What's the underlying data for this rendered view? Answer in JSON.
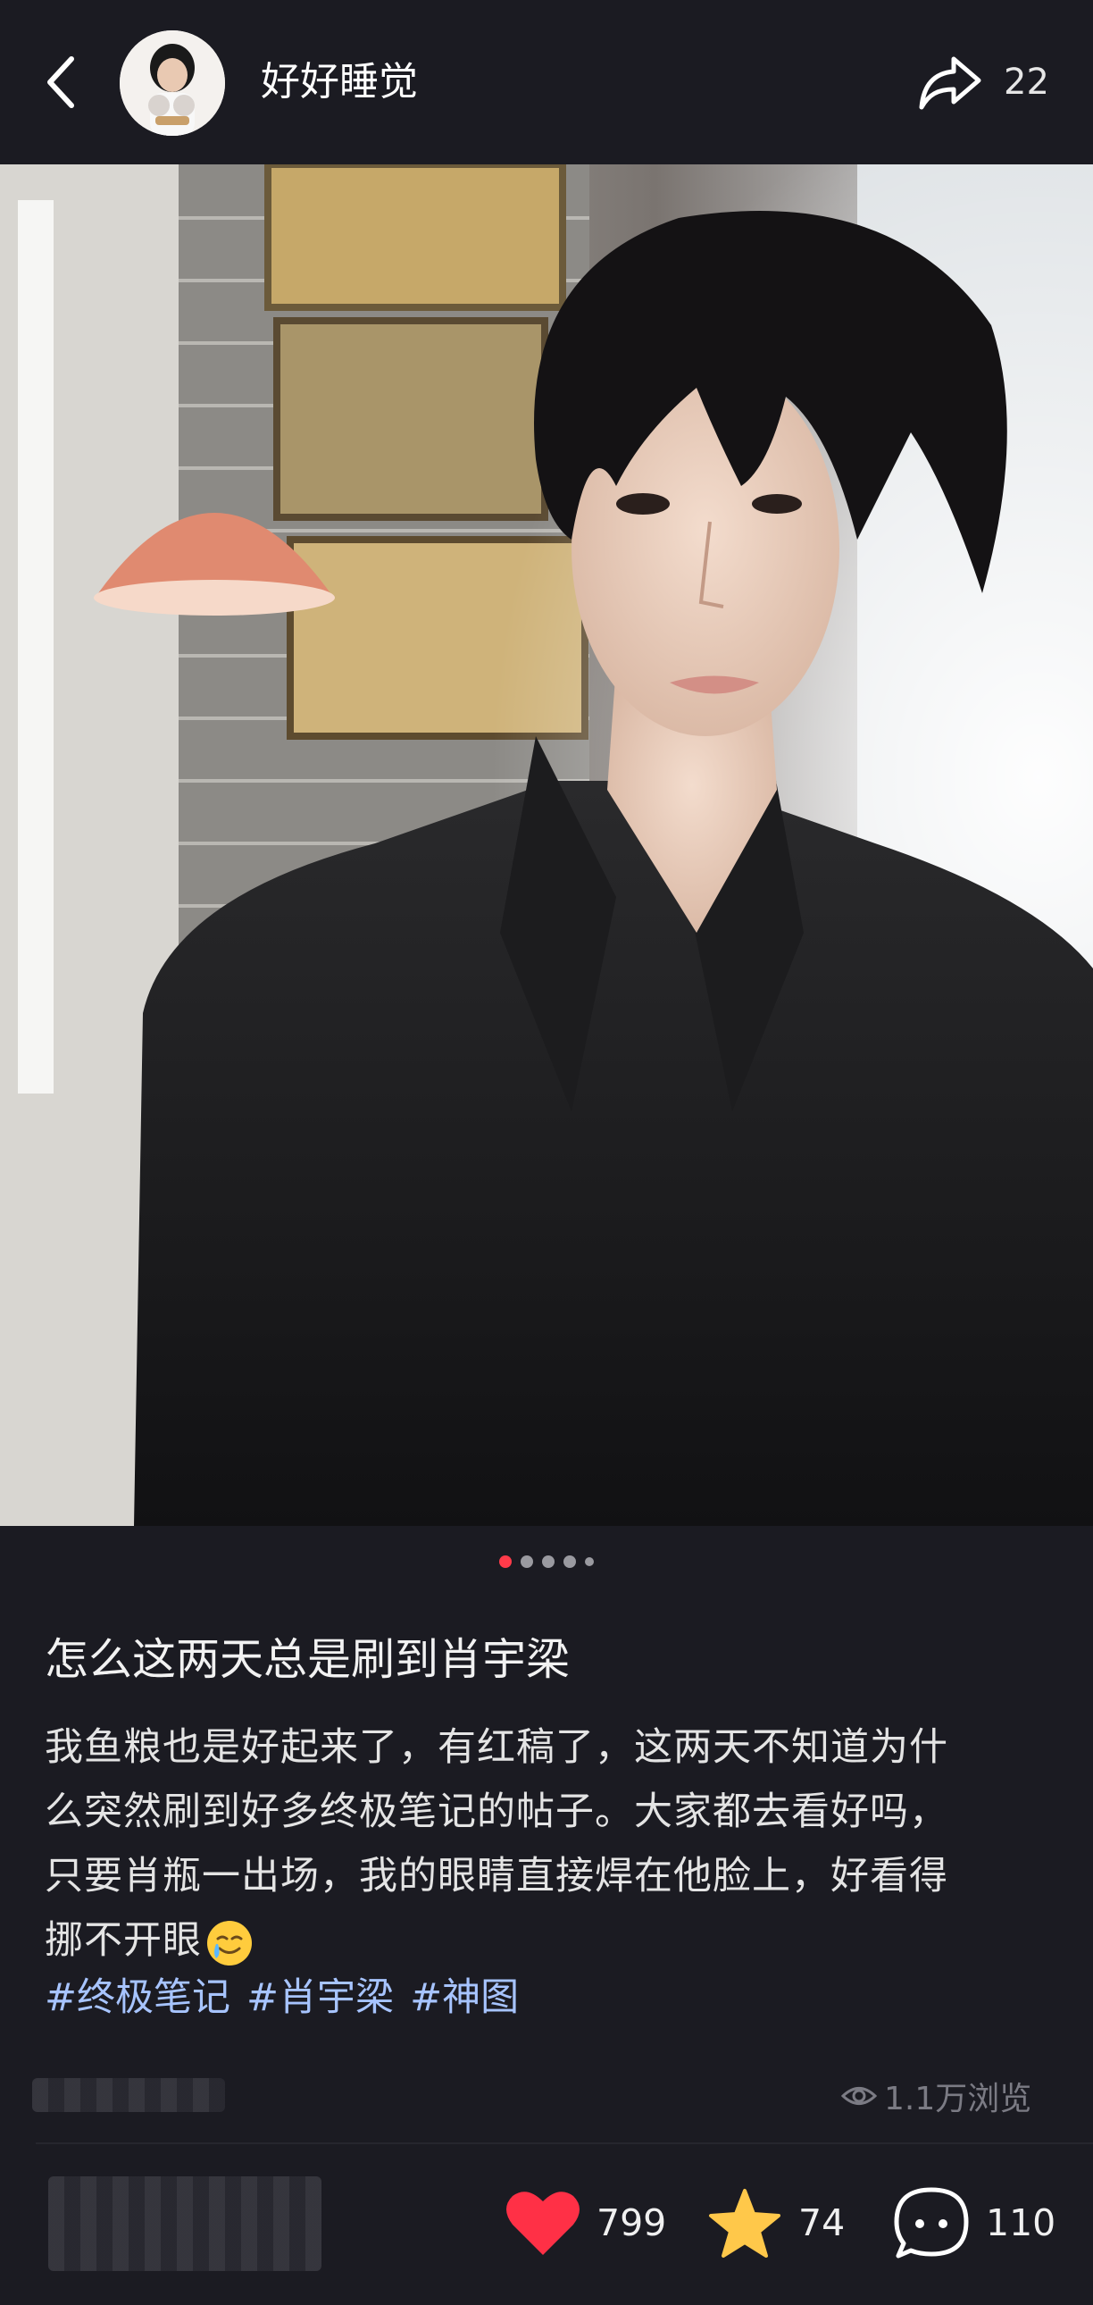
{
  "header": {
    "username": "好好睡觉",
    "share_count": "22"
  },
  "gallery": {
    "total_images": 5,
    "current_index": 1
  },
  "post": {
    "title": "怎么这两天总是刷到肖宇梁",
    "body_lines": [
      "我鱼粮也是好起来了，有红稿了，这两天不知道为什",
      "么突然刷到好多终极笔记的帖子。大家都去看好吗，",
      "只要肖瓶一出场，我的眼睛直接焊在他脸上，好看得",
      "挪不开眼"
    ],
    "tags": [
      "#终极笔记",
      "#肖宇梁",
      "#神图"
    ],
    "views": "1.1万浏览"
  },
  "actions": {
    "like_count": "799",
    "favorite_count": "74",
    "comment_count": "110"
  },
  "colors": {
    "background": "#1b1b22",
    "like_red": "#ff3046",
    "star_yellow": "#ffc84a",
    "tag_blue": "#a7c4ff",
    "active_dot": "#ff3b4a"
  },
  "icons": [
    "back-icon",
    "share-icon",
    "eye-icon",
    "heart-icon",
    "star-icon",
    "comment-icon",
    "crying-smile-emoji"
  ]
}
